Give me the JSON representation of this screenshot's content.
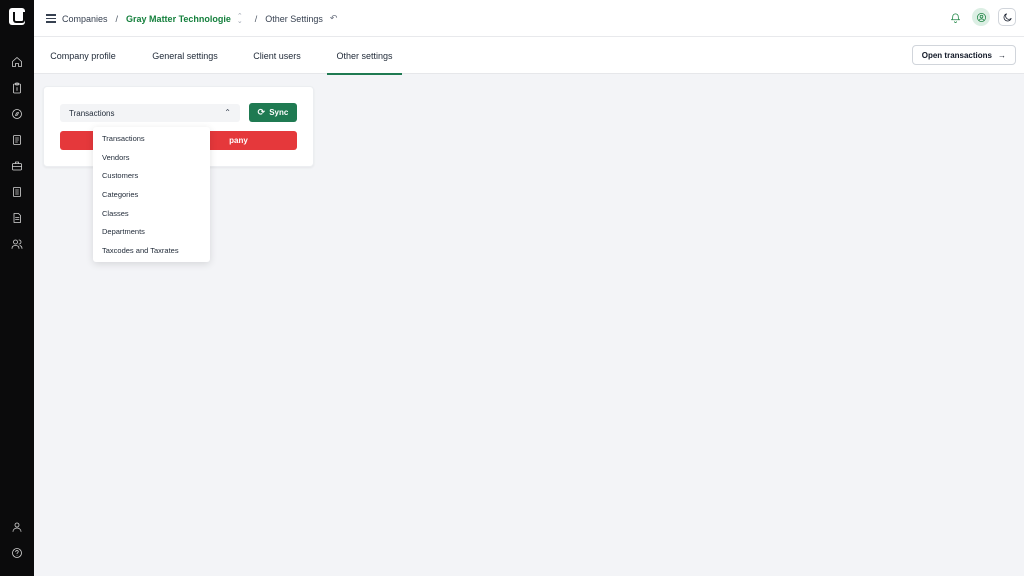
{
  "sidebar": {
    "items": [
      {
        "icon": "home-icon"
      },
      {
        "icon": "clipboard-icon"
      },
      {
        "icon": "compass-icon"
      },
      {
        "icon": "document-icon"
      },
      {
        "icon": "briefcase-icon"
      },
      {
        "icon": "ledger-icon"
      },
      {
        "icon": "receipt-icon"
      },
      {
        "icon": "users-icon"
      }
    ],
    "bottom": [
      {
        "icon": "profile-icon"
      },
      {
        "icon": "help-icon"
      }
    ]
  },
  "breadcrumb": {
    "root": "Companies",
    "separator": "/",
    "company": "Gray Matter Technologie",
    "current": "Other Settings"
  },
  "tabs": [
    {
      "label": "Company profile",
      "active": false
    },
    {
      "label": "General settings",
      "active": false
    },
    {
      "label": "Client users",
      "active": false
    },
    {
      "label": "Other settings",
      "active": true
    }
  ],
  "actions": {
    "open_transactions": "Open transactions"
  },
  "card": {
    "select_value": "Transactions",
    "sync_label": "Sync",
    "danger_label_visible": "pany"
  },
  "dropdown": {
    "options": [
      "Transactions",
      "Vendors",
      "Customers",
      "Categories",
      "Classes",
      "Departments",
      "Taxcodes and Taxrates"
    ]
  },
  "colors": {
    "accent": "#1f7a52",
    "danger": "#e5383b",
    "sidebar": "#0b0b0c",
    "background": "#f3f4f7"
  }
}
